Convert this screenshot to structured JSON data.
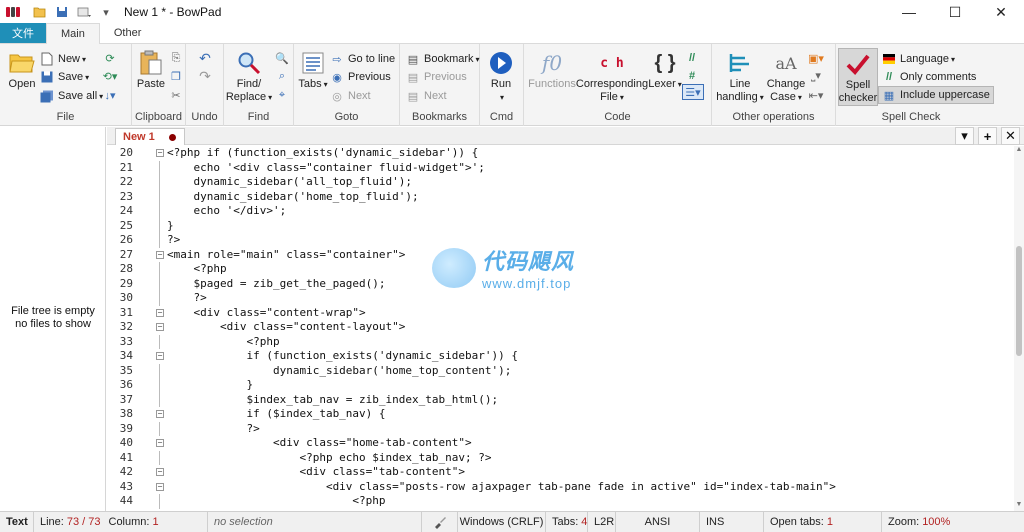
{
  "window": {
    "title": "New 1 * - BowPad",
    "controls": [
      "—",
      "☐",
      "✕"
    ]
  },
  "ribbon_tabs": [
    {
      "label": "文件"
    },
    {
      "label": "Main"
    },
    {
      "label": "Other"
    }
  ],
  "ribbon": {
    "file": {
      "label": "File",
      "open": "Open",
      "new": "New",
      "save": "Save",
      "save_all": "Save all"
    },
    "clipboard": {
      "label": "Clipboard",
      "paste": "Paste"
    },
    "undo": {
      "label": "Undo"
    },
    "find": {
      "label": "Find",
      "find_replace_1": "Find/",
      "find_replace_2": "Replace"
    },
    "goto": {
      "label": "Goto",
      "tabs": "Tabs",
      "go_to_line": "Go to line",
      "previous": "Previous",
      "next": "Next"
    },
    "bookmarks": {
      "label": "Bookmarks",
      "bookmark": "Bookmark",
      "previous": "Previous",
      "next": "Next"
    },
    "cmd": {
      "label": "Cmd",
      "run": "Run"
    },
    "code": {
      "label": "Code",
      "functions": "Functions",
      "corresponding_1": "Corresponding",
      "corresponding_2": "File",
      "lexer": "Lexer",
      "functions_icon": "f0",
      "corresponding_icon": "c h"
    },
    "other_ops": {
      "label": "Other operations",
      "line_handling_1": "Line",
      "line_handling_2": "handling",
      "change_case_1": "Change",
      "change_case_2": "Case"
    },
    "spell": {
      "label": "Spell Check",
      "checker_1": "Spell",
      "checker_2": "checker",
      "language": "Language",
      "only_comments": "Only comments",
      "include_uppercase": "Include uppercase"
    }
  },
  "left_panel": {
    "empty_line1": "File tree is empty",
    "empty_line2": "no files to show"
  },
  "doc_tabs": {
    "active_tab": "New 1",
    "buttons": [
      "▾",
      "+",
      "✕"
    ]
  },
  "editor": {
    "lines": [
      {
        "n": "20",
        "fold": "box",
        "code": "<?php if (function_exists('dynamic_sidebar')) {"
      },
      {
        "n": "21",
        "fold": "",
        "code": "    echo '<div class=\"container fluid-widget\">';"
      },
      {
        "n": "22",
        "fold": "",
        "code": "    dynamic_sidebar('all_top_fluid');"
      },
      {
        "n": "23",
        "fold": "",
        "code": "    dynamic_sidebar('home_top_fluid');"
      },
      {
        "n": "24",
        "fold": "",
        "code": "    echo '</div>';"
      },
      {
        "n": "25",
        "fold": "",
        "code": "}"
      },
      {
        "n": "26",
        "fold": "",
        "code": "?>"
      },
      {
        "n": "27",
        "fold": "box",
        "code": "<main role=\"main\" class=\"container\">"
      },
      {
        "n": "28",
        "fold": "",
        "code": "    <?php"
      },
      {
        "n": "29",
        "fold": "",
        "code": "    $paged = zib_get_the_paged();"
      },
      {
        "n": "30",
        "fold": "",
        "code": "    ?>"
      },
      {
        "n": "31",
        "fold": "box",
        "code": "    <div class=\"content-wrap\">"
      },
      {
        "n": "32",
        "fold": "box",
        "code": "        <div class=\"content-layout\">"
      },
      {
        "n": "33",
        "fold": "",
        "code": "            <?php"
      },
      {
        "n": "34",
        "fold": "box",
        "code": "            if (function_exists('dynamic_sidebar')) {"
      },
      {
        "n": "35",
        "fold": "",
        "code": "                dynamic_sidebar('home_top_content');"
      },
      {
        "n": "36",
        "fold": "",
        "code": "            }"
      },
      {
        "n": "37",
        "fold": "",
        "code": "            $index_tab_nav = zib_index_tab_html();"
      },
      {
        "n": "38",
        "fold": "box",
        "code": "            if ($index_tab_nav) {"
      },
      {
        "n": "39",
        "fold": "",
        "code": "            ?>"
      },
      {
        "n": "40",
        "fold": "box",
        "code": "                <div class=\"home-tab-content\">"
      },
      {
        "n": "41",
        "fold": "",
        "code": "                    <?php echo $index_tab_nav; ?>"
      },
      {
        "n": "42",
        "fold": "box",
        "code": "                    <div class=\"tab-content\">"
      },
      {
        "n": "43",
        "fold": "box",
        "code": "                        <div class=\"posts-row ajaxpager tab-pane fade in active\" id=\"index-tab-main\">"
      },
      {
        "n": "44",
        "fold": "",
        "code": "                            <?php"
      }
    ]
  },
  "watermark": {
    "cn": "代码飓风",
    "url": "www.dmjf.top"
  },
  "status": {
    "mode": "Text",
    "line_label": "Line:",
    "line_value": "73 / 73",
    "column_label": "Column:",
    "column_value": "1",
    "selection": "no selection",
    "eol": "Windows (CRLF)",
    "tabs_label": "Tabs:",
    "tabs_value": "4",
    "direction": "L2R",
    "encoding": "ANSI",
    "insert": "INS",
    "open_tabs_label": "Open tabs:",
    "open_tabs_value": "1",
    "zoom_label": "Zoom:",
    "zoom_value": "100%"
  },
  "colors": {
    "file_tab": "#1f8fb8",
    "accent_red": "#b22222",
    "ribbon_bg": "#f4f4f4"
  }
}
